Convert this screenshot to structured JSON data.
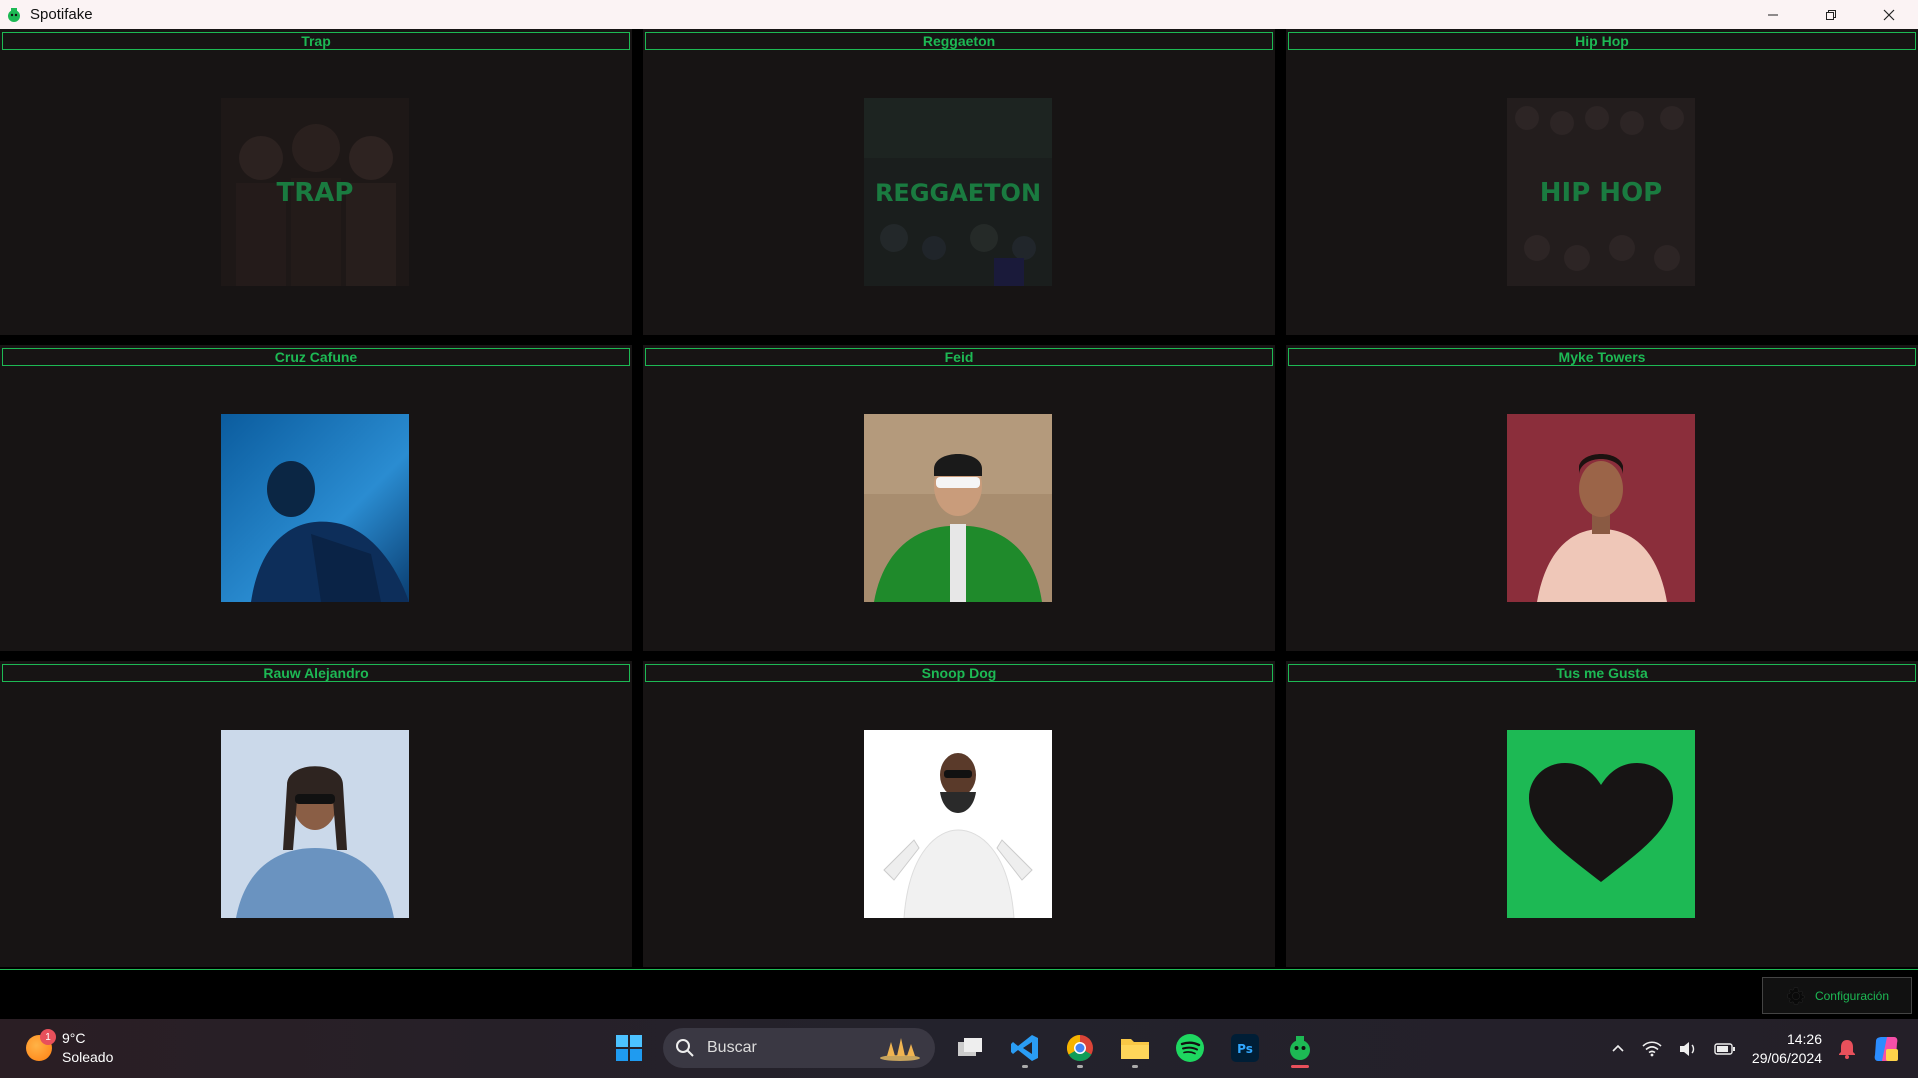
{
  "window": {
    "title": "Spotifake"
  },
  "cells": [
    {
      "label": "Trap",
      "art": "TRAP",
      "kind": "genre",
      "colors": [
        "#2a201f",
        "#3b2d2a"
      ]
    },
    {
      "label": "Reggaeton",
      "art": "REGGAETON",
      "kind": "genre",
      "colors": [
        "#1d2323",
        "#252b27"
      ]
    },
    {
      "label": "Hip Hop",
      "art": "HIP HOP",
      "kind": "genre",
      "colors": [
        "#292424",
        "#332a2a"
      ]
    },
    {
      "label": "Cruz Cafune",
      "kind": "artist",
      "colors": [
        "#0c4a86",
        "#2c8bd0",
        "#061a33"
      ]
    },
    {
      "label": "Feid",
      "kind": "artist",
      "colors": [
        "#a68c70",
        "#1f8b2a",
        "#2b1d18"
      ]
    },
    {
      "label": "Myke Towers",
      "kind": "artist",
      "colors": [
        "#8c2d3a",
        "#f1c7b6",
        "#5a1e25"
      ]
    },
    {
      "label": "Rauw Alejandro",
      "kind": "artist",
      "colors": [
        "#cfdcec",
        "#5d86b4",
        "#3b2a25"
      ]
    },
    {
      "label": "Snoop Dog",
      "kind": "artist",
      "colors": [
        "#ffffff",
        "#f2f2f2",
        "#2b2b2b"
      ]
    },
    {
      "label": "Tus me Gusta",
      "kind": "liked",
      "colors": [
        "#1db954",
        "#171414"
      ]
    }
  ],
  "bottom": {
    "config_label": "Configuración"
  },
  "taskbar": {
    "weather_temp": "9°C",
    "weather_desc": "Soleado",
    "weather_badge": "1",
    "search_placeholder": "Buscar",
    "time": "14:26",
    "date": "29/06/2024"
  },
  "colors": {
    "accent": "#1db954",
    "panel": "#171414"
  }
}
